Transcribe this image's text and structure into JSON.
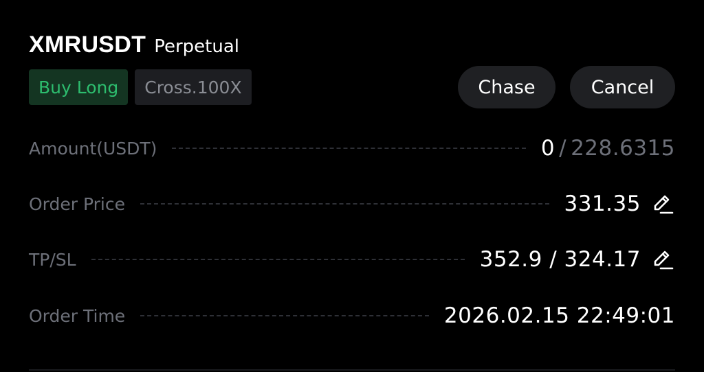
{
  "order": {
    "symbol": "XMRUSDT",
    "contract_type": "Perpetual",
    "side_tag": "Buy Long",
    "margin_tag": "Cross.100X"
  },
  "actions": {
    "chase_label": "Chase",
    "cancel_label": "Cancel"
  },
  "details": {
    "amount": {
      "label": "Amount(USDT)",
      "filled": "0",
      "separator": "/",
      "total": "228.6315"
    },
    "order_price": {
      "label": "Order Price",
      "value": "331.35"
    },
    "tpsl": {
      "label": "TP/SL",
      "value": "352.9 / 324.17"
    },
    "order_time": {
      "label": "Order Time",
      "value": "2026.02.15 22:49:01"
    }
  },
  "icons": {
    "edit": "edit-pencil-icon"
  },
  "colors": {
    "background": "#000000",
    "buy_green": "#2dbd6e",
    "buy_tag_bg": "#143522",
    "muted_text": "#6d7079",
    "button_bg": "#1f2023"
  }
}
